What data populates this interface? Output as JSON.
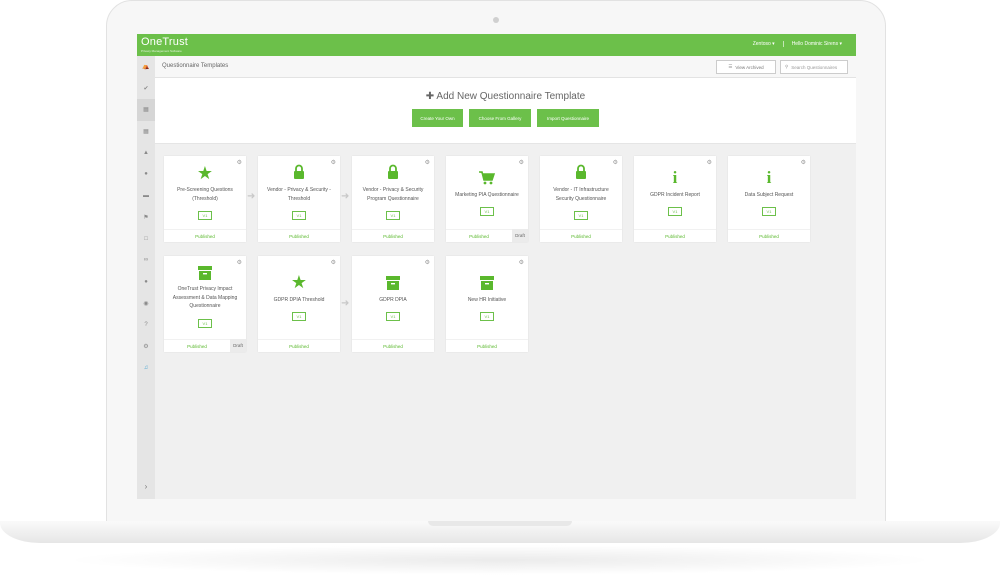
{
  "app": {
    "logo": "OneTrust",
    "tagline": "Privacy Management Software",
    "company_menu": "Zentoso ▾",
    "user_menu": "Hello Dominic Sirens ▾"
  },
  "header": {
    "title": "Questionnaire Templates",
    "view_archived": "View Archived",
    "search_placeholder": "Search Questionnaires"
  },
  "add_panel": {
    "title": "✚  Add New Questionnaire Template",
    "buttons": [
      "Create Your Own",
      "Choose From Gallery",
      "Import Questionnaire"
    ]
  },
  "cards": [
    {
      "name": "Pre-Screening Questions (Threshold)",
      "version": "V1",
      "status": "Published",
      "icon": "star-icon"
    },
    {
      "name": "Vendor - Privacy & Security - Threshold",
      "version": "V1",
      "status": "Published",
      "icon": "lock-icon"
    },
    {
      "name": "Vendor - Privacy & Security Program Questionnaire",
      "version": "V1",
      "status": "Published",
      "icon": "lock-icon"
    },
    {
      "name": "Marketing PIA Questionnaire",
      "version": "V1",
      "status": "Published",
      "draft": "Draft",
      "icon": "cart-icon"
    },
    {
      "name": "Vendor - IT Infrastructure Security Questionnaire",
      "version": "V1",
      "status": "Published",
      "icon": "lock-icon"
    },
    {
      "name": "GDPR Incident Report",
      "version": "V1",
      "status": "Published",
      "icon": "info-icon"
    },
    {
      "name": "Data Subject Request",
      "version": "V1",
      "status": "Published",
      "icon": "info-icon"
    },
    {
      "name": "OneTrust Privacy Impact Assessment & Data Mapping Questionnaire",
      "version": "V1",
      "status": "Published",
      "draft": "Draft",
      "icon": "archive-box-icon"
    },
    {
      "name": "GDPR DPIA Threshold",
      "version": "V1",
      "status": "Published",
      "icon": "star-icon"
    },
    {
      "name": "GDPR DPIA",
      "version": "V1",
      "status": "Published",
      "icon": "archive-box-icon"
    },
    {
      "name": "New HR Initiative",
      "version": "V1",
      "status": "Published",
      "icon": "archive-box-icon"
    }
  ],
  "sidebar_icons": [
    "home-icon",
    "check-icon",
    "document-icon",
    "grid-icon",
    "building-icon",
    "globe-icon",
    "database-icon",
    "flag-icon",
    "folder-icon",
    "link-icon",
    "user-icon",
    "users-icon",
    "help-icon",
    "gear-icon",
    "megaphone-icon"
  ],
  "colors": {
    "brand_green": "#6cc04a",
    "icon_green": "#5ab82d",
    "promo_blue": "#3da0d0"
  }
}
